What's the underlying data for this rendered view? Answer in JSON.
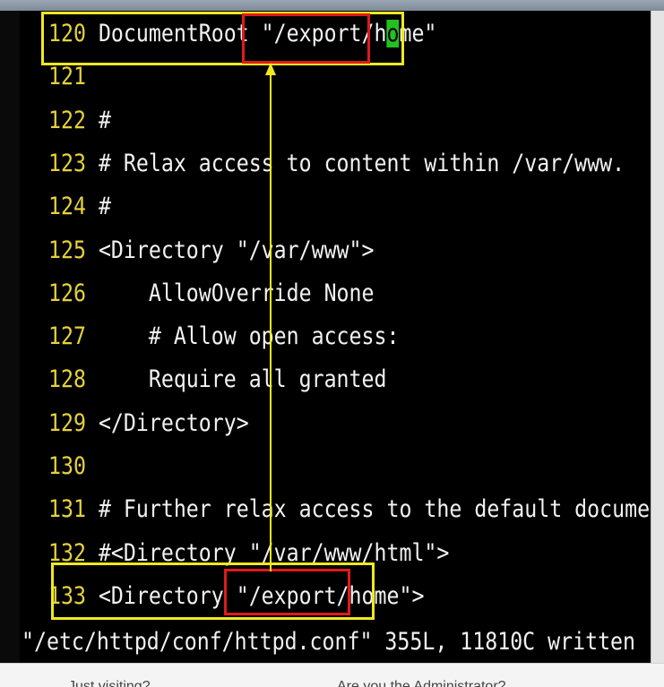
{
  "editor": {
    "lines": [
      {
        "num": "120",
        "pre": "DocumentRoot \"/export/h",
        "cursor": "o",
        "post": "me\""
      },
      {
        "num": "121",
        "pre": "",
        "cursor": "",
        "post": ""
      },
      {
        "num": "122",
        "pre": "#",
        "cursor": "",
        "post": ""
      },
      {
        "num": "123",
        "pre": "# Relax access to content within /var/www.",
        "cursor": "",
        "post": ""
      },
      {
        "num": "124",
        "pre": "#",
        "cursor": "",
        "post": ""
      },
      {
        "num": "125",
        "pre": "<Directory \"/var/www\">",
        "cursor": "",
        "post": ""
      },
      {
        "num": "126",
        "pre": "    AllowOverride None",
        "cursor": "",
        "post": ""
      },
      {
        "num": "127",
        "pre": "    # Allow open access:",
        "cursor": "",
        "post": ""
      },
      {
        "num": "128",
        "pre": "    Require all granted",
        "cursor": "",
        "post": ""
      },
      {
        "num": "129",
        "pre": "</Directory>",
        "cursor": "",
        "post": ""
      },
      {
        "num": "130",
        "pre": "",
        "cursor": "",
        "post": ""
      },
      {
        "num": "131",
        "pre": "# Further relax access to the default document root:",
        "cursor": "",
        "post": ""
      },
      {
        "num": "132",
        "pre": "#<Directory \"/var/www/html\">",
        "cursor": "",
        "post": ""
      },
      {
        "num": "133",
        "pre": "<Directory \"/export/home\">",
        "cursor": "",
        "post": ""
      }
    ]
  },
  "statusline": {
    "message": "\"/etc/httpd/conf/httpd.conf\" 355L, 11810C written"
  },
  "below_window": {
    "left_text": "Just visiting?",
    "right_text": "Are you the Administrator?"
  },
  "colors": {
    "line_number": "#e5d23a",
    "text": "#f2f2f2",
    "cursor": "#23c023",
    "highlight_yellow": "#f0e91e",
    "highlight_red": "#e01a1a"
  }
}
